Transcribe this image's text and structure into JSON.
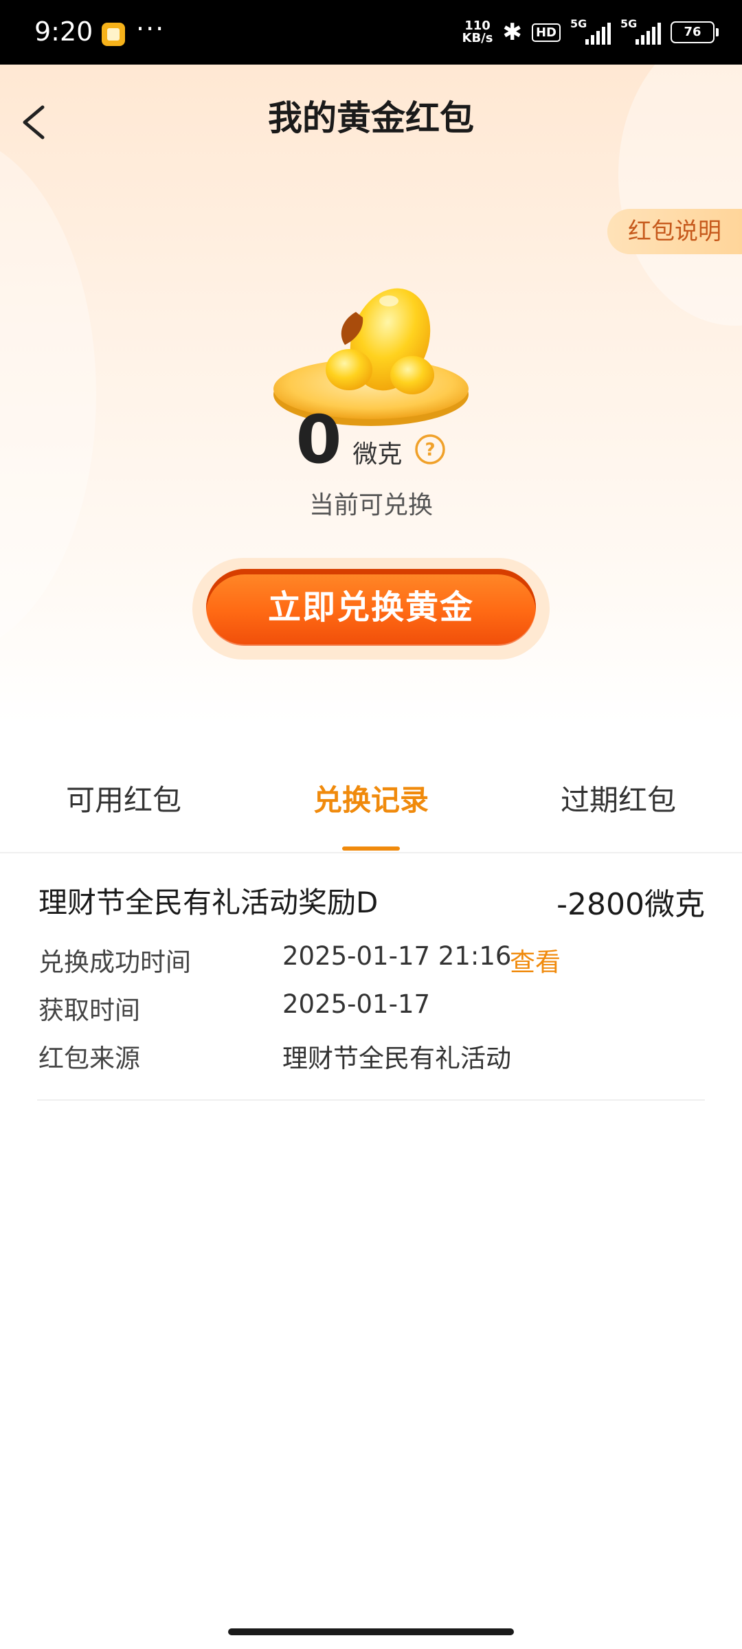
{
  "status_bar": {
    "time": "9:20",
    "net_speed_top": "110",
    "net_speed_bottom": "KB/s",
    "hd_label": "HD",
    "network_label": "5G",
    "battery": "76"
  },
  "header": {
    "title": "我的黄金红包",
    "explain_label": "红包说明"
  },
  "balance": {
    "amount": "0",
    "unit": "微克",
    "caption": "当前可兑换",
    "redeem_label": "立即兑换黄金"
  },
  "tabs": [
    {
      "label": "可用红包",
      "active": false
    },
    {
      "label": "兑换记录",
      "active": true
    },
    {
      "label": "过期红包",
      "active": false
    }
  ],
  "records": [
    {
      "title": "理财节全民有礼活动奖励D",
      "amount": "-2800微克",
      "rows": [
        {
          "label": "兑换成功时间",
          "value": "2025-01-17 21:16",
          "link": "查看"
        },
        {
          "label": "获取时间",
          "value": "2025-01-17"
        },
        {
          "label": "红包来源",
          "value": "理财节全民有礼活动"
        }
      ]
    }
  ],
  "colors": {
    "accent": "#f08a0c",
    "button": "#ff6a14"
  }
}
